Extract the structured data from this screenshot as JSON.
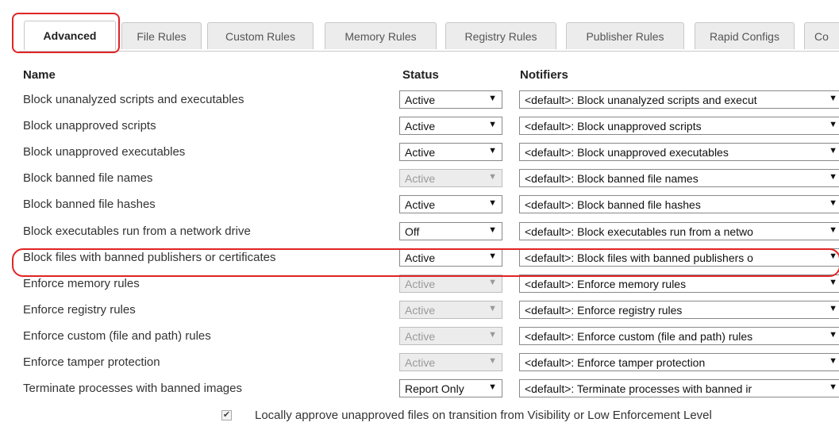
{
  "tabs": [
    {
      "label": "Advanced",
      "active": true
    },
    {
      "label": "File Rules"
    },
    {
      "label": "Custom Rules"
    },
    {
      "label": "Memory Rules"
    },
    {
      "label": "Registry Rules"
    },
    {
      "label": "Publisher Rules"
    },
    {
      "label": "Rapid Configs"
    },
    {
      "label": "Co"
    }
  ],
  "headers": {
    "name": "Name",
    "status": "Status",
    "notifiers": "Notifiers"
  },
  "rows": [
    {
      "name": "Block unanalyzed scripts and executables",
      "status": "Active",
      "status_enabled": true,
      "notifier": "<default>: Block unanalyzed scripts and execut"
    },
    {
      "name": "Block unapproved scripts",
      "status": "Active",
      "status_enabled": true,
      "notifier": "<default>: Block unapproved scripts"
    },
    {
      "name": "Block unapproved executables",
      "status": "Active",
      "status_enabled": true,
      "notifier": "<default>: Block unapproved executables"
    },
    {
      "name": "Block banned file names",
      "status": "Active",
      "status_enabled": false,
      "notifier": "<default>: Block banned file names"
    },
    {
      "name": "Block banned file hashes",
      "status": "Active",
      "status_enabled": true,
      "notifier": "<default>: Block banned file hashes"
    },
    {
      "name": "Block executables run from a network drive",
      "status": "Off",
      "status_enabled": true,
      "notifier": "<default>: Block executables run from a netwo"
    },
    {
      "name": "Block files with banned publishers or certificates",
      "status": "Active",
      "status_enabled": true,
      "notifier": "<default>: Block files with banned publishers o",
      "highlighted": true
    },
    {
      "name": "Enforce memory rules",
      "status": "Active",
      "status_enabled": false,
      "notifier": "<default>: Enforce memory rules"
    },
    {
      "name": "Enforce registry rules",
      "status": "Active",
      "status_enabled": false,
      "notifier": "<default>: Enforce registry rules"
    },
    {
      "name": "Enforce custom (file and path) rules",
      "status": "Active",
      "status_enabled": false,
      "notifier": "<default>: Enforce custom (file and path) rules"
    },
    {
      "name": "Enforce tamper protection",
      "status": "Active",
      "status_enabled": false,
      "notifier": "<default>: Enforce tamper protection"
    },
    {
      "name": "Terminate processes with banned images",
      "status": "Report Only",
      "status_enabled": true,
      "notifier": "<default>: Terminate processes with banned ir"
    }
  ],
  "footer": {
    "checkbox_checked": true,
    "label": "Locally approve unapproved files on transition from Visibility or Low Enforcement Level"
  },
  "icons": {
    "dropdown_arrow": "▼",
    "check": "✔"
  },
  "colors": {
    "highlight": "#e02424",
    "disabled_bg": "#ececec"
  }
}
